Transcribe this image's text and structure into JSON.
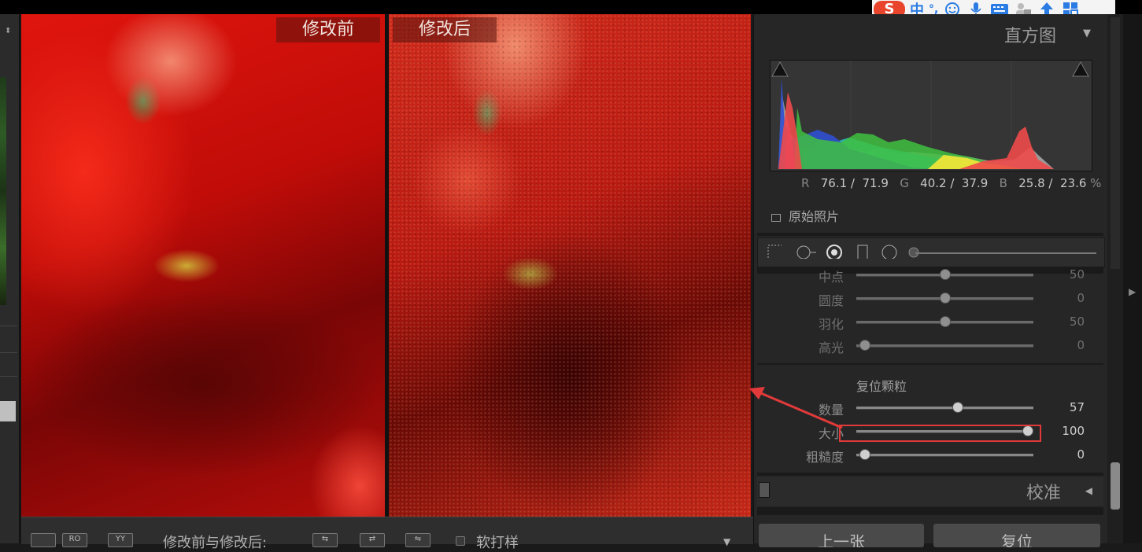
{
  "ime": {
    "logo": "S",
    "mode": "中",
    "punct": "°,",
    "icons": [
      "smiley-icon",
      "microphone-icon",
      "keyboard-icon",
      "person-icon",
      "upload-icon",
      "grid-icon"
    ]
  },
  "preview": {
    "before_label": "修改前",
    "after_label": "修改后"
  },
  "toolbar": {
    "before_after_label": "修改前与修改后:",
    "softproof_label": "软打样",
    "view_btn1": "",
    "view_btn2": "RO",
    "view_btn3": "YY"
  },
  "histogram": {
    "title": "直方图",
    "r_label": "R",
    "r_value": "76.1 /  71.9",
    "g_label": "G",
    "g_value": "40.2 /  37.9",
    "b_label": "B",
    "b_value": "25.8 /  23.6",
    "percent": "%",
    "original_photo_label": "原始照片"
  },
  "effects": {
    "rows": [
      {
        "label": "中点",
        "value": "50",
        "pos": 0.5
      },
      {
        "label": "圆度",
        "value": "0",
        "pos": 0.5
      },
      {
        "label": "羽化",
        "value": "50",
        "pos": 0.5
      },
      {
        "label": "高光",
        "value": "0",
        "pos": 0.0
      }
    ],
    "grain_title": "复位颗粒",
    "grain_rows": [
      {
        "label": "数量",
        "value": "57",
        "pos": 0.57
      },
      {
        "label": "大小",
        "value": "100",
        "pos": 1.0
      },
      {
        "label": "粗糙度",
        "value": "0",
        "pos": 0.0
      }
    ]
  },
  "calibration": {
    "title": "校准"
  },
  "nav": {
    "previous": "上一张",
    "reset": "复位"
  },
  "colors": {
    "annotation_red": "#e23a3a"
  }
}
